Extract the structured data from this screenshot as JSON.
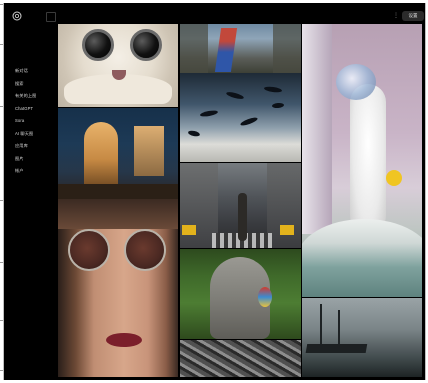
{
  "app": {
    "logo_icon": "openai-logo-icon",
    "sidebar_toggle_icon": "sidebar-toggle-icon"
  },
  "sidebar": {
    "items": [
      {
        "label": "新对话"
      },
      {
        "label": "搜索"
      },
      {
        "label": "有关的上图"
      },
      {
        "label": "ChatGPT"
      },
      {
        "label": "Sora"
      },
      {
        "label": "AI 聊天图"
      },
      {
        "label": "应用库"
      },
      {
        "label": "图片"
      },
      {
        "label": "帐户"
      }
    ]
  },
  "header": {
    "user_badge": "设置",
    "menu_icon": "more-vertical-icon"
  },
  "gallery": {
    "tiles": [
      {
        "id": "creature",
        "subject": "cute-creature-image"
      },
      {
        "id": "street",
        "subject": "street-flag-image"
      },
      {
        "id": "dolphins",
        "subject": "dolphins-sky-image"
      },
      {
        "id": "bubble",
        "subject": "bubble-monster-bath-image"
      },
      {
        "id": "shop",
        "subject": "shop-window-night-image"
      },
      {
        "id": "city",
        "subject": "city-street-image"
      },
      {
        "id": "woman",
        "subject": "woman-round-glasses-image"
      },
      {
        "id": "statue",
        "subject": "statue-parrot-image"
      },
      {
        "id": "roots",
        "subject": "tree-roots-image"
      },
      {
        "id": "ship",
        "subject": "ship-storm-image"
      }
    ]
  }
}
